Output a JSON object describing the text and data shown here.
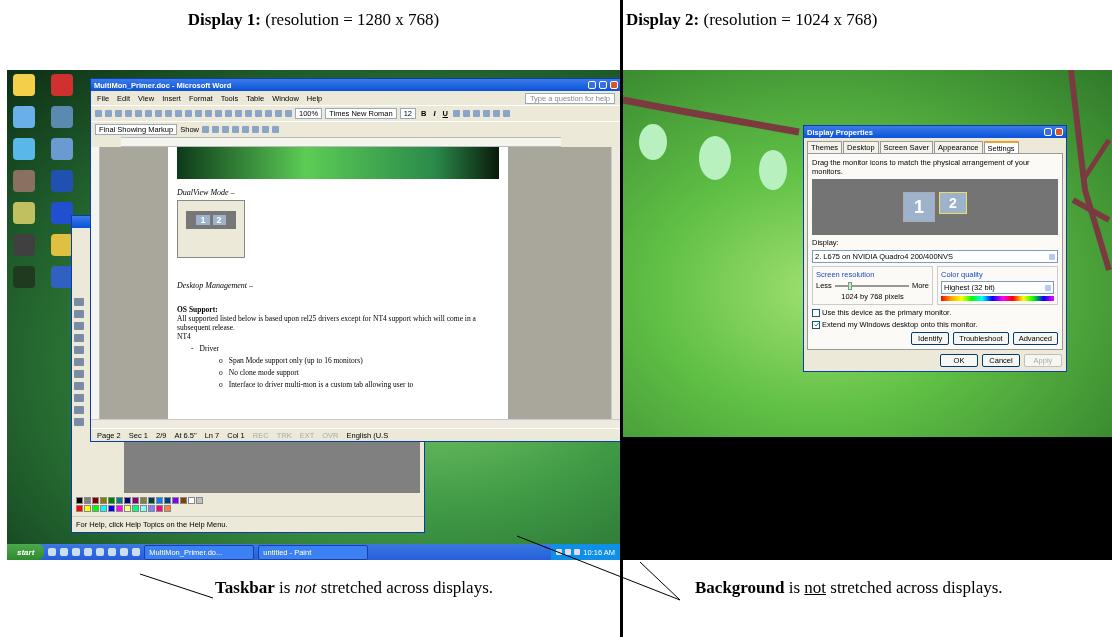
{
  "captions_top": [
    "**Display 1:** (resolution = 1280 x 768)",
    "**Display 2:** (resolution = 1024 x 768)"
  ],
  "display1": {
    "word": {
      "title": "MultiMon_Primer.doc - Microsoft Word",
      "menu": [
        "File",
        "Edit",
        "View",
        "Insert",
        "Format",
        "Tools",
        "Table",
        "Window",
        "Help"
      ],
      "help_placeholder": "Type a question for help",
      "zoom": "100%",
      "font": "Times New Roman",
      "size": "12",
      "format_buttons": [
        "B",
        "I",
        "U"
      ],
      "markup": "Final Showing Markup",
      "show": "Show",
      "doc": {
        "heading_1": "DualView Mode –",
        "thumbnail_monitors": [
          "1",
          "2"
        ],
        "heading_2": "Desktop Management –",
        "section": "OS Support:",
        "paragraph": "All supported listed below is based upon rel25 drivers except for NT4 support which will come in a subsequent release.",
        "os": "NT4",
        "list": [
          {
            "marker": "-",
            "text": "Driver",
            "children": [
              {
                "marker": "o",
                "text": "Span Mode support only (up to 16 monitors)"
              },
              {
                "marker": "o",
                "text": "No clone mode support"
              },
              {
                "marker": "o",
                "text": "Interface to driver multi-mon is a custom tab allowing user to"
              }
            ]
          }
        ]
      },
      "status": [
        {
          "text": "Page 2",
          "disabled": false
        },
        {
          "text": "Sec 1",
          "disabled": false
        },
        {
          "text": "2/9",
          "disabled": false
        },
        {
          "text": "At 6.5\"",
          "disabled": false
        },
        {
          "text": "Ln 7",
          "disabled": false
        },
        {
          "text": "Col 1",
          "disabled": false
        },
        {
          "text": "REC",
          "disabled": true
        },
        {
          "text": "TRK",
          "disabled": true
        },
        {
          "text": "EXT",
          "disabled": true
        },
        {
          "text": "OVR",
          "disabled": true
        },
        {
          "text": "English (U.S",
          "disabled": false
        }
      ]
    },
    "paint": {
      "status": "For Help, click Help Topics on the Help Menu."
    },
    "taskbar": {
      "start": "start",
      "tasks": [
        "MultiMon_Primer.do...",
        "untitled - Paint"
      ],
      "clock": "10:16 AM"
    }
  },
  "display2": {
    "dialog": {
      "title": "Display Properties",
      "tabs": [
        {
          "label": "Themes",
          "selected": false
        },
        {
          "label": "Desktop",
          "selected": false
        },
        {
          "label": "Screen Saver",
          "selected": false
        },
        {
          "label": "Appearance",
          "selected": false
        },
        {
          "label": "Settings",
          "selected": true
        }
      ],
      "instruction": "Drag the monitor icons to match the physical arrangement of your monitors.",
      "monitors": [
        {
          "label": "1",
          "selected": false
        },
        {
          "label": "2",
          "selected": true
        }
      ],
      "display_label": "Display:",
      "display_value": "2. L675 on NVIDIA Quadro4 200/400NVS",
      "resolution": {
        "title": "Screen resolution",
        "less": "Less",
        "more": "More",
        "level": 0.2,
        "reading": "1024 by 768 pixels"
      },
      "color": {
        "title": "Color quality",
        "value": "Highest (32 bit)"
      },
      "checkboxes": [
        {
          "label": "Use this device as the primary monitor.",
          "checked": false
        },
        {
          "label": "Extend my Windows desktop onto this monitor.",
          "checked": true
        }
      ],
      "buttons": [
        {
          "label": "Identify",
          "disabled": false
        },
        {
          "label": "Troubleshoot",
          "disabled": false
        },
        {
          "label": "Advanced",
          "disabled": false
        }
      ],
      "footer_buttons": [
        {
          "label": "OK",
          "disabled": false
        },
        {
          "label": "Cancel",
          "disabled": false
        },
        {
          "label": "Apply",
          "disabled": true
        }
      ]
    }
  },
  "captions_bottom": [
    {
      "lead": "Taskbar",
      "mid": "is",
      "emph": {
        "text": "not",
        "kind": "italic"
      },
      "rest": "stretched across displays."
    },
    {
      "lead": "Background",
      "mid": "is",
      "emph": {
        "text": "not",
        "kind": "underline"
      },
      "rest": "stretched across displays."
    }
  ]
}
